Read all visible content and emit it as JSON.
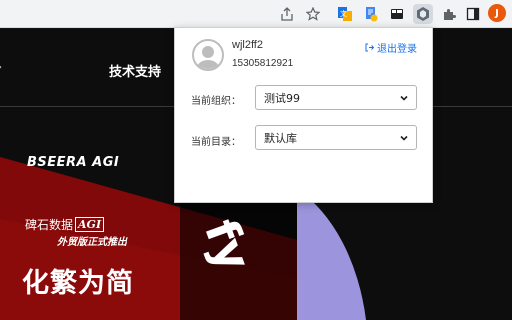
{
  "toolbar": {
    "icons": [
      "share-icon",
      "star-icon",
      "extension-translate-icon",
      "extension-doc-icon",
      "extension-board-icon",
      "extension-bseera-icon",
      "puzzle-icon",
      "sidepanel-icon"
    ],
    "profile_initial": "J",
    "profile_color": "#e8590c"
  },
  "site": {
    "nav_item": "技术支持",
    "brand": "BSEERA AGI",
    "cn_brand": "碑石数据",
    "cn_brand_badge": "AGI",
    "sub_brand": "外贸版正式推出",
    "slogan": "化繁为简",
    "colors": {
      "red": "#8b0a0a",
      "purple": "#9c95de"
    }
  },
  "popup": {
    "user_name": "wjl2ff2",
    "user_phone": "15305812921",
    "logout_label": "退出登录",
    "org_label": "当前组织：",
    "org_value": "测试99",
    "dir_label": "当前目录：",
    "dir_value": "默认库"
  }
}
